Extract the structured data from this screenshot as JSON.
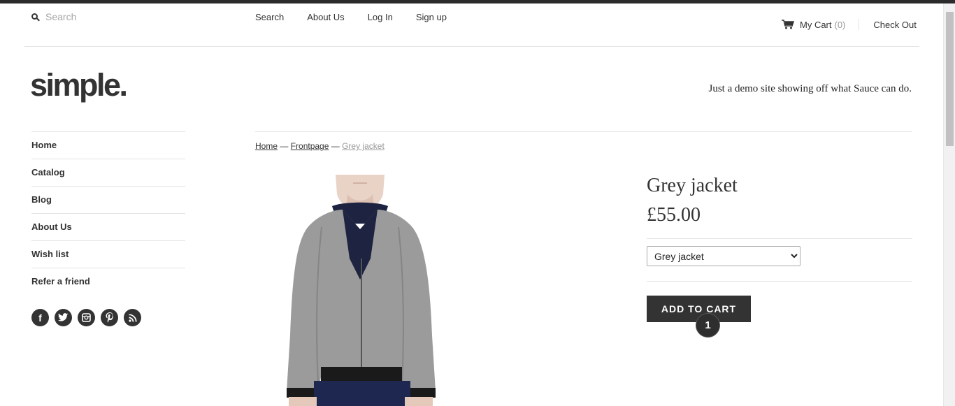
{
  "header": {
    "search_placeholder": "Search",
    "nav": [
      "Search",
      "About Us",
      "Log In",
      "Sign up"
    ],
    "cart_label": "My Cart",
    "cart_count": "(0)",
    "checkout_label": "Check Out"
  },
  "brand": {
    "logo": "simple.",
    "tagline": "Just a demo site showing off what Sauce can do."
  },
  "sidebar": {
    "items": [
      "Home",
      "Catalog",
      "Blog",
      "About Us",
      "Wish list",
      "Refer a friend"
    ],
    "social": [
      {
        "name": "facebook-icon",
        "glyph": "f"
      },
      {
        "name": "twitter-icon",
        "glyph": "t"
      },
      {
        "name": "instagram-icon",
        "glyph": "◘"
      },
      {
        "name": "pinterest-icon",
        "glyph": "p"
      },
      {
        "name": "rss-icon",
        "glyph": ")"
      }
    ]
  },
  "breadcrumb": {
    "home": "Home",
    "sep": "—",
    "frontpage": "Frontpage",
    "current": "Grey jacket"
  },
  "product": {
    "title": "Grey jacket",
    "price": "£55.00",
    "variant_selected": "Grey jacket",
    "add_to_cart_label": "ADD TO CART",
    "step_badge": "1"
  },
  "colors": {
    "accent": "#333333",
    "jacket": "#9b9b9b",
    "shirt": "#1d2340",
    "skin": "#e9d3c6"
  }
}
